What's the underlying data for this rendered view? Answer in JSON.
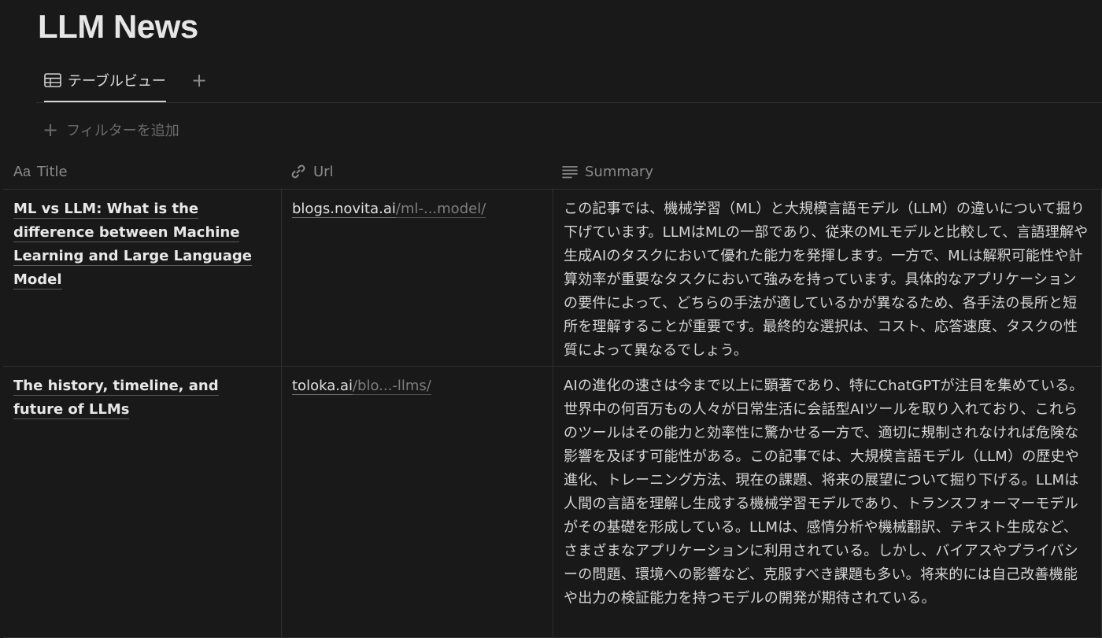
{
  "page": {
    "title": "LLM News"
  },
  "views": {
    "active_tab_label": "テーブルビュー",
    "add_view_symbol": "+"
  },
  "filter": {
    "label": "フィルターを追加",
    "symbol": "+"
  },
  "table": {
    "columns": [
      {
        "icon": "text-type-icon",
        "icon_text": "Aa",
        "label": "Title"
      },
      {
        "icon": "link-icon",
        "label": "Url"
      },
      {
        "icon": "text-lines-icon",
        "label": "Summary"
      }
    ],
    "rows": [
      {
        "title": "ML vs LLM: What is the difference between Machine Learning and Large Language Model",
        "url_host": "blogs.novita.ai",
        "url_path": "/ml-...model/",
        "summary": "この記事では、機械学習（ML）と大規模言語モデル（LLM）の違いについて掘り下げています。LLMはMLの一部であり、従来のMLモデルと比較して、言語理解や生成AIのタスクにおいて優れた能力を発揮します。一方で、MLは解釈可能性や計算効率が重要なタスクにおいて強みを持っています。具体的なアプリケーションの要件によって、どちらの手法が適しているかが異なるため、各手法の長所と短所を理解することが重要です。最終的な選択は、コスト、応答速度、タスクの性質によって異なるでしょう。"
      },
      {
        "title": "The history, timeline, and future of LLMs",
        "url_host": "toloka.ai",
        "url_path": "/blo...-llms/",
        "summary": "AIの進化の速さは今まで以上に顕著であり、特にChatGPTが注目を集めている。世界中の何百万もの人々が日常生活に会話型AIツールを取り入れており、これらのツールはその能力と効率性に驚かせる一方で、適切に規制されなければ危険な影響を及ぼす可能性がある。この記事では、大規模言語モデル（LLM）の歴史や進化、トレーニング方法、現在の課題、将来の展望について掘り下げる。LLMは人間の言語を理解し生成する機械学習モデルであり、トランスフォーマーモデルがその基礎を形成している。LLMは、感情分析や機械翻訳、テキスト生成など、さまざまなアプリケーションに利用されている。しかし、バイアスやプライバシーの問題、環境への影響など、克服すべき課題も多い。将来的には自己改善機能や出力の検証能力を持つモデルの開発が期待されている。"
      }
    ]
  }
}
